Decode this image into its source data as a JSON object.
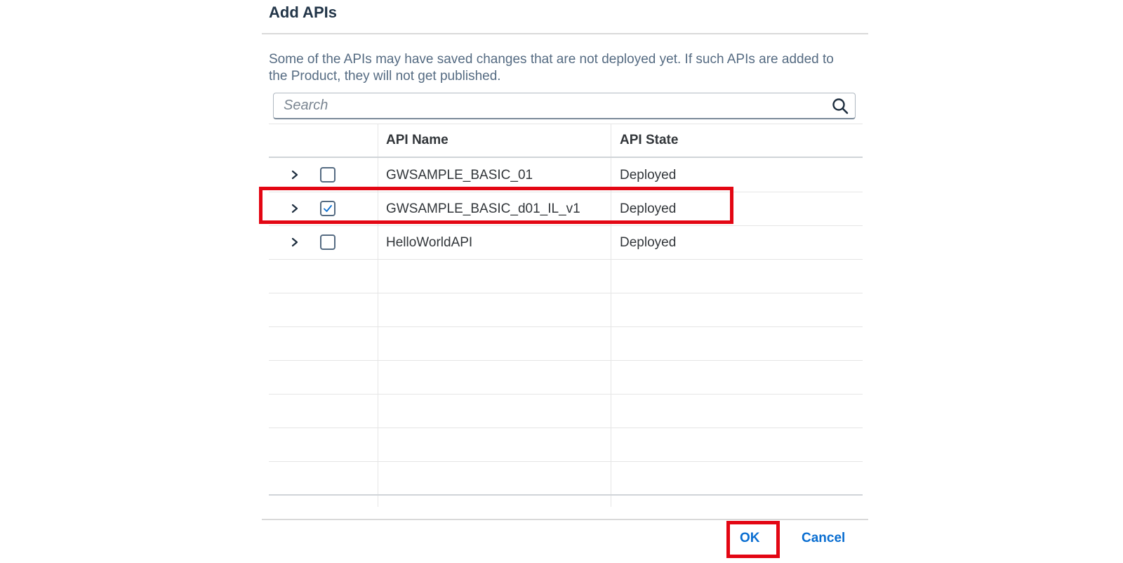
{
  "dialog": {
    "title": "Add APIs",
    "info_text": "Some of the APIs may have saved changes that are not deployed yet. If such APIs are added to the Product, they will not get published."
  },
  "search": {
    "placeholder": "Search",
    "value": ""
  },
  "table": {
    "columns": [
      "API Name",
      "API State"
    ],
    "rows": [
      {
        "name": "GWSAMPLE_BASIC_01",
        "state": "Deployed",
        "checked": false
      },
      {
        "name": "GWSAMPLE_BASIC_d01_IL_v1",
        "state": "Deployed",
        "checked": true
      },
      {
        "name": "HelloWorldAPI",
        "state": "Deployed",
        "checked": false
      }
    ],
    "empty_row_count": 7
  },
  "footer": {
    "ok_label": "OK",
    "cancel_label": "Cancel"
  },
  "colors": {
    "accent": "#0a6ed1",
    "highlight": "#e30613",
    "title": "#223548",
    "text": "#32363a"
  },
  "icons": {
    "search": "search-icon",
    "expand": "chevron-right-icon",
    "check": "check-icon"
  }
}
